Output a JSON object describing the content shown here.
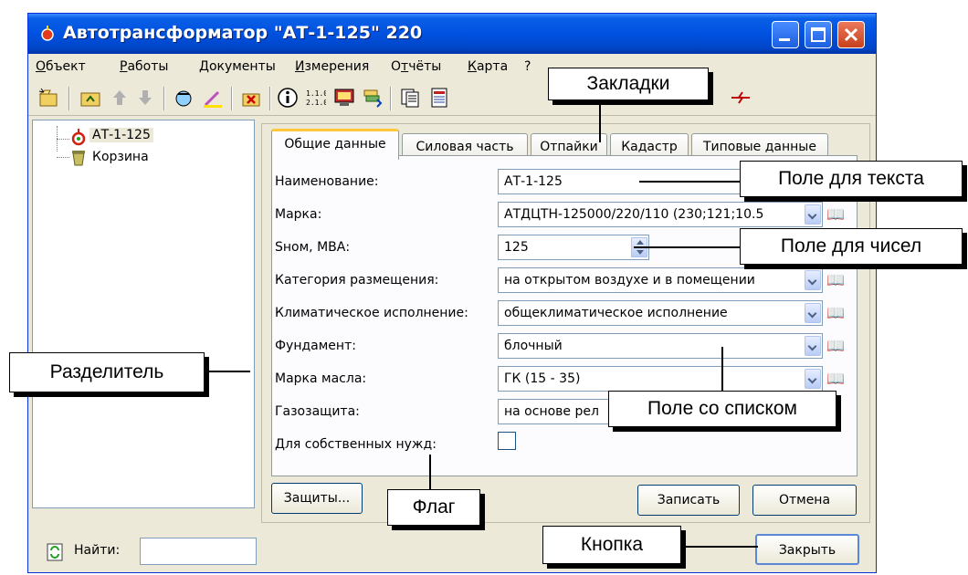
{
  "window": {
    "title": "Автотрансформатор \"АТ-1-125\" 220"
  },
  "menu": [
    {
      "first": "О",
      "rest": "бъект"
    },
    {
      "first": "Р",
      "rest": "аботы"
    },
    {
      "first": "Д",
      "rest": "окументы"
    },
    {
      "first": "И",
      "rest": "змерения"
    },
    {
      "first": "",
      "pre": "О",
      "u": "т",
      "rest": "чёты"
    },
    {
      "first": "К",
      "rest": "арта"
    },
    {
      "first": "",
      "rest": "?"
    }
  ],
  "tree": {
    "items": [
      "АТ-1-125",
      "Корзина"
    ]
  },
  "search": {
    "label": "Найти:",
    "value": ""
  },
  "tabs": [
    "Общие данные",
    "Силовая часть",
    "Отпайки",
    "Кадастр",
    "Типовые данные"
  ],
  "form": {
    "name_label": "Наименование:",
    "name_value": "АТ-1-125",
    "brand_label": "Марка:",
    "brand_value": "АТДЦТН-125000/220/110 (230;121;10.5",
    "snom_label": "Sном, МВА:",
    "snom_value": "125",
    "category_label": "Категория размещения:",
    "category_value": "на открытом воздухе и в помещении",
    "climate_label": "Климатическое исполнение:",
    "climate_value": "общеклиматическое исполнение",
    "foundation_label": "Фундамент:",
    "foundation_value": "блочный",
    "oil_label": "Марка масла:",
    "oil_value": "ГК (15 - 35)",
    "gas_label": "Газозащита:",
    "gas_value": "на основе рел",
    "own_needs_label": "Для собственных нужд:",
    "own_needs_checked": false
  },
  "buttons": {
    "protections": "Защиты...",
    "save": "Записать",
    "cancel": "Отмена",
    "close": "Закрыть"
  },
  "callouts": {
    "tabs": "Закладки",
    "text_field": "Поле для текста",
    "number_field": "Поле для чисел",
    "splitter": "Разделитель",
    "combo": "Поле со списком",
    "flag": "Флаг",
    "button": "Кнопка"
  },
  "colors": {
    "titlebar": "#0051e0",
    "window_bg": "#ece9d8",
    "active_tab_accent": "#ffc83c"
  }
}
